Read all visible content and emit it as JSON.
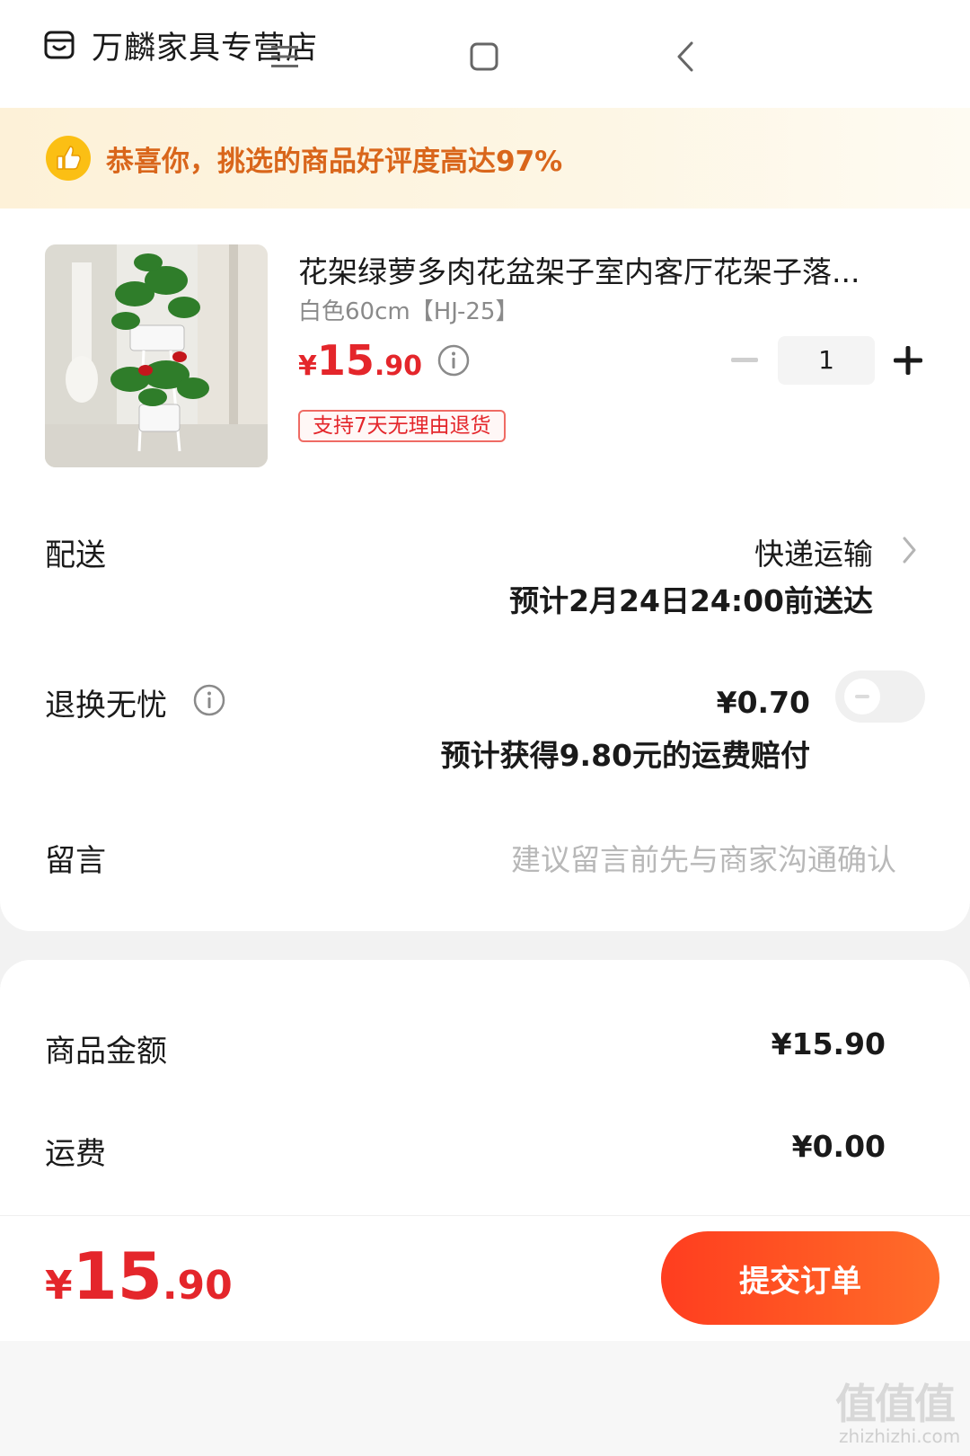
{
  "store": {
    "name": "万麟家具专营店",
    "icon": "store-icon"
  },
  "banner": {
    "text": "恭喜你，挑选的商品好评度高达97%",
    "icon": "thumbs-up-icon"
  },
  "product": {
    "title": "花架绿萝多肉花盆架子室内客厅花架子落...",
    "spec": "白色60cm【HJ-25】",
    "price_currency": "¥",
    "price_int": "15",
    "price_dec": ".90",
    "quantity": "1",
    "return_badge": "支持7天无理由退货"
  },
  "delivery": {
    "label": "配送",
    "method": "快递运输",
    "eta": "预计2月24日24:00前送达"
  },
  "return_insurance": {
    "label": "退换无忧",
    "fee": "¥0.70",
    "compensation": "预计获得9.80元的运费赔付",
    "enabled": false
  },
  "message": {
    "label": "留言",
    "placeholder": "建议留言前先与商家沟通确认"
  },
  "summary": {
    "goods_label": "商品金额",
    "goods_value": "¥15.90",
    "shipping_label": "运费",
    "shipping_value": "¥0.00"
  },
  "checkout": {
    "total_currency": "¥",
    "total_int": "15",
    "total_dec": ".90",
    "submit_label": "提交订单"
  },
  "watermark": {
    "mark": "值值值",
    "text": "zhizhizhi.com"
  },
  "colors": {
    "accent_red": "#e4262b",
    "banner_orange": "#d9661b",
    "button_orange": "#ff5a24"
  }
}
